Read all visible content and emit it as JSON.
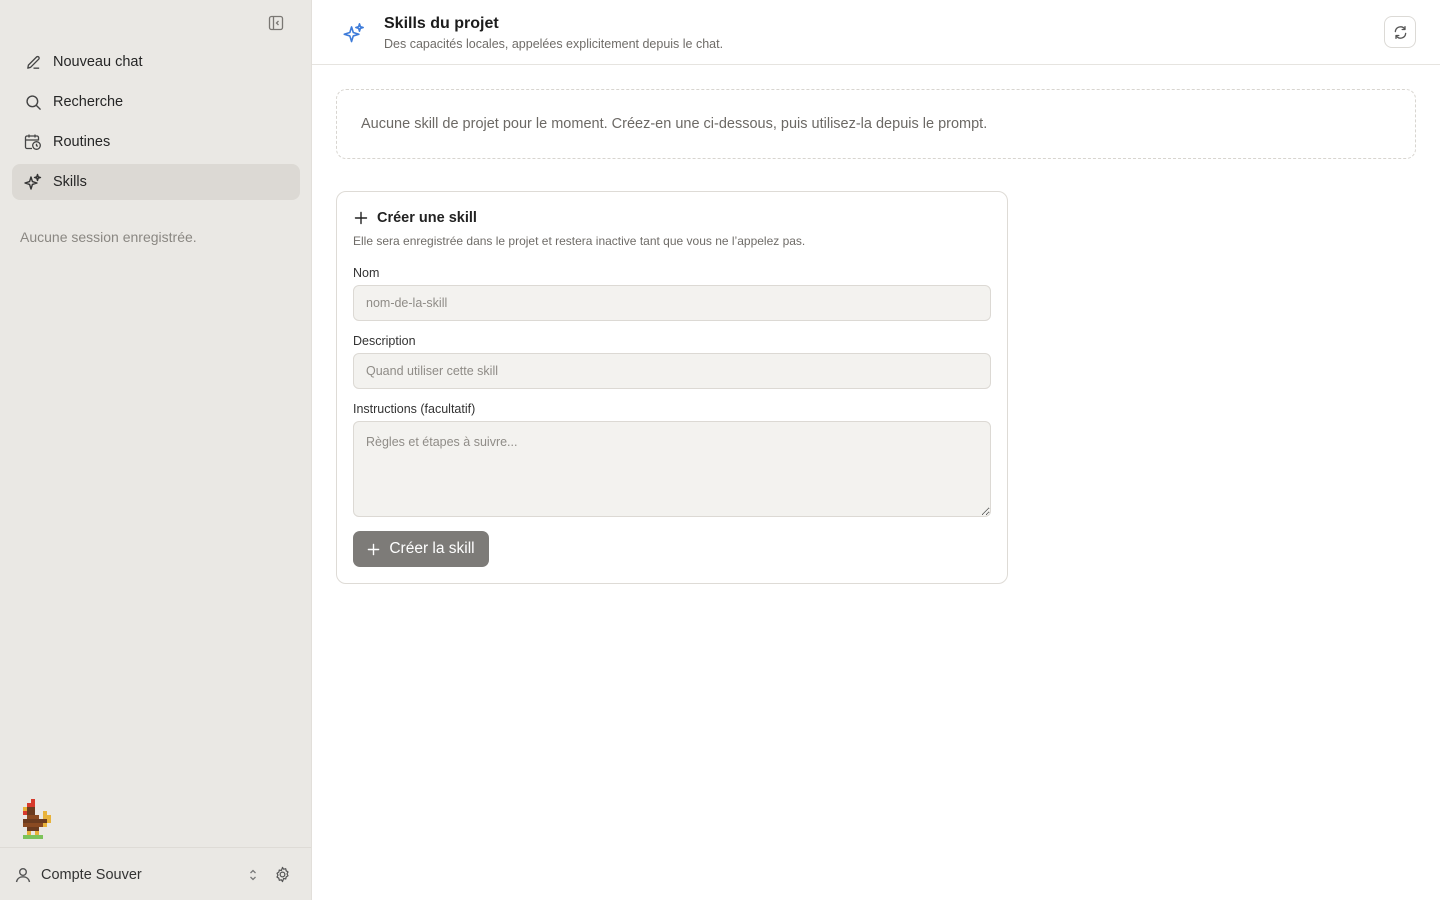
{
  "sidebar": {
    "items": [
      {
        "label": "Nouveau chat",
        "icon": "pencil-icon"
      },
      {
        "label": "Recherche",
        "icon": "search-icon"
      },
      {
        "label": "Routines",
        "icon": "calendar-clock-icon"
      },
      {
        "label": "Skills",
        "icon": "sparkles-icon",
        "active": true
      }
    ],
    "empty_sessions": "Aucune session enregistrée.",
    "account_label": "Compte Souver"
  },
  "header": {
    "title": "Skills du projet",
    "subtitle": "Des capacités locales, appelées explicitement depuis le chat."
  },
  "empty_state": {
    "message": "Aucune skill de projet pour le moment. Créez-en une ci-dessous, puis utilisez-la depuis le prompt."
  },
  "form": {
    "title": "Créer une skill",
    "subtitle": "Elle sera enregistrée dans le projet et restera inactive tant que vous ne l’appelez pas.",
    "name_label": "Nom",
    "name_placeholder": "nom-de-la-skill",
    "description_label": "Description",
    "description_placeholder": "Quand utiliser cette skill",
    "instructions_label": "Instructions (facultatif)",
    "instructions_placeholder": "Règles et étapes à suivre...",
    "submit_label": "Créer la skill"
  },
  "colors": {
    "sidebar_bg": "#eae8e4",
    "active_item_bg": "#dcd9d4",
    "accent_icon": "#3d7bd9",
    "button_bg": "#7d7b78"
  }
}
